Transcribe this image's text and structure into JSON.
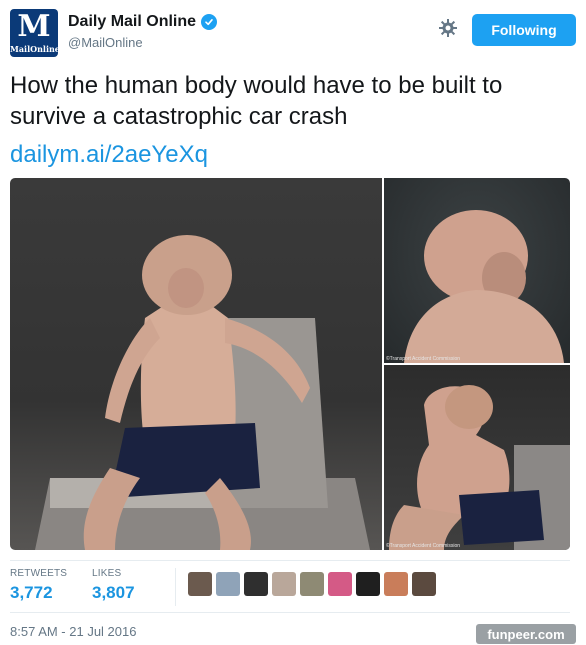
{
  "tweet": {
    "author": {
      "display_name": "Daily Mail Online",
      "handle": "@MailOnline",
      "avatar_letter": "M",
      "avatar_wordmark": "MailOnline",
      "verified": true,
      "verified_icon": "verified-check-icon"
    },
    "settings_icon": "gear-icon",
    "follow_button_label": "Following",
    "text": "How the human body would have to be built to survive a catastrophic car crash",
    "link": "dailym.ai/2aeYeXq",
    "media": {
      "photo_credits": [
        "©Transport Accident Commission",
        "©Transport Accident Commission"
      ]
    },
    "stats": {
      "retweets_label": "RETWEETS",
      "retweets_value": "3,772",
      "likes_label": "LIKES",
      "likes_value": "3,807"
    },
    "likers_avatar_colors": [
      "#6b5a4e",
      "#8fa3b8",
      "#2f2f2f",
      "#b9a79a",
      "#8e8a74",
      "#d45a86",
      "#1f1f1f",
      "#c97d5a",
      "#5b4a3f"
    ],
    "timestamp": "8:57 AM - 21 Jul 2016"
  },
  "watermark": "funpeer.com",
  "colors": {
    "brand_blue": "#1da1f2",
    "link_blue": "#1b95e0",
    "muted_gray": "#657786",
    "avatar_navy": "#0b3a78"
  }
}
